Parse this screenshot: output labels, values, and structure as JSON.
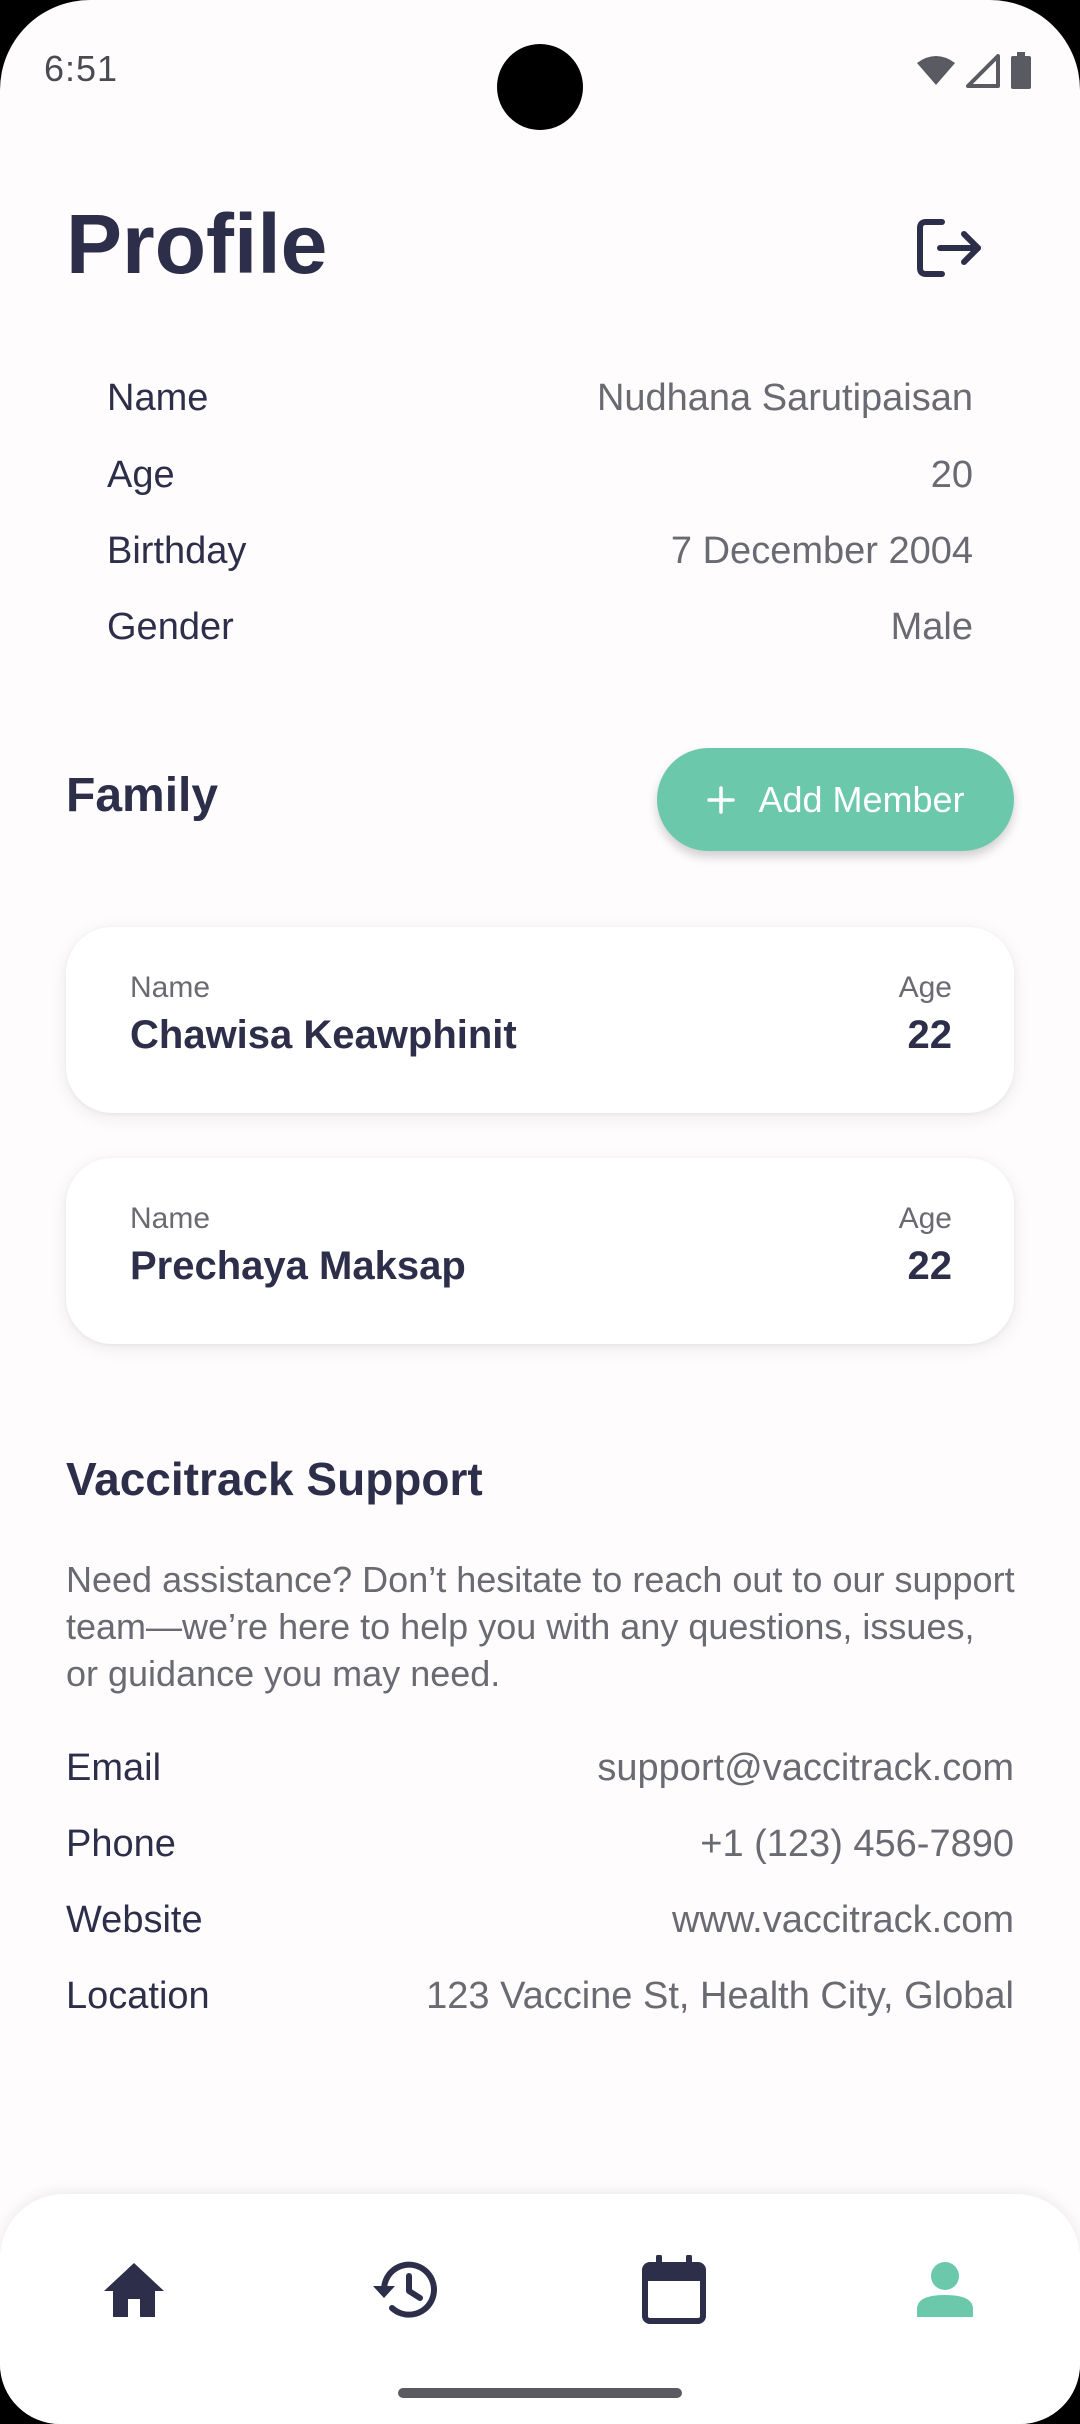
{
  "status_bar": {
    "time": "6:51",
    "icons": [
      "wifi-icon",
      "signal-icon",
      "battery-icon"
    ]
  },
  "header": {
    "title": "Profile",
    "logout_icon": "logout-icon"
  },
  "profile": {
    "fields": [
      {
        "label": "Name",
        "value": "Nudhana Sarutipaisan"
      },
      {
        "label": "Age",
        "value": "20"
      },
      {
        "label": "Birthday",
        "value": "7 December 2004"
      },
      {
        "label": "Gender",
        "value": "Male"
      }
    ]
  },
  "family": {
    "title": "Family",
    "add_button_label": "Add Member",
    "members": [
      {
        "name_label": "Name",
        "name": "Chawisa Keawphinit",
        "age_label": "Age",
        "age": "22"
      },
      {
        "name_label": "Name",
        "name": "Prechaya Maksap",
        "age_label": "Age",
        "age": "22"
      }
    ]
  },
  "support": {
    "title": "Vaccitrack Support",
    "description": "Need assistance? Don’t hesitate to reach out to our support team—we’re here to help you with any questions, issues, or guidance you may need.",
    "contacts": [
      {
        "label": "Email",
        "value": "support@vaccitrack.com"
      },
      {
        "label": "Phone",
        "value": "+1 (123) 456-7890"
      },
      {
        "label": "Website",
        "value": "www.vaccitrack.com"
      },
      {
        "label": "Location",
        "value": "123 Vaccine St, Health City, Global"
      }
    ]
  },
  "bottom_nav": {
    "items": [
      {
        "icon": "home-icon",
        "active": false
      },
      {
        "icon": "history-icon",
        "active": false
      },
      {
        "icon": "calendar-icon",
        "active": false
      },
      {
        "icon": "person-icon",
        "active": true
      }
    ]
  },
  "colors": {
    "primary_text": "#2d2f4a",
    "secondary_text": "#6a6a72",
    "accent": "#6bc8ab",
    "background": "#fefcfd"
  }
}
